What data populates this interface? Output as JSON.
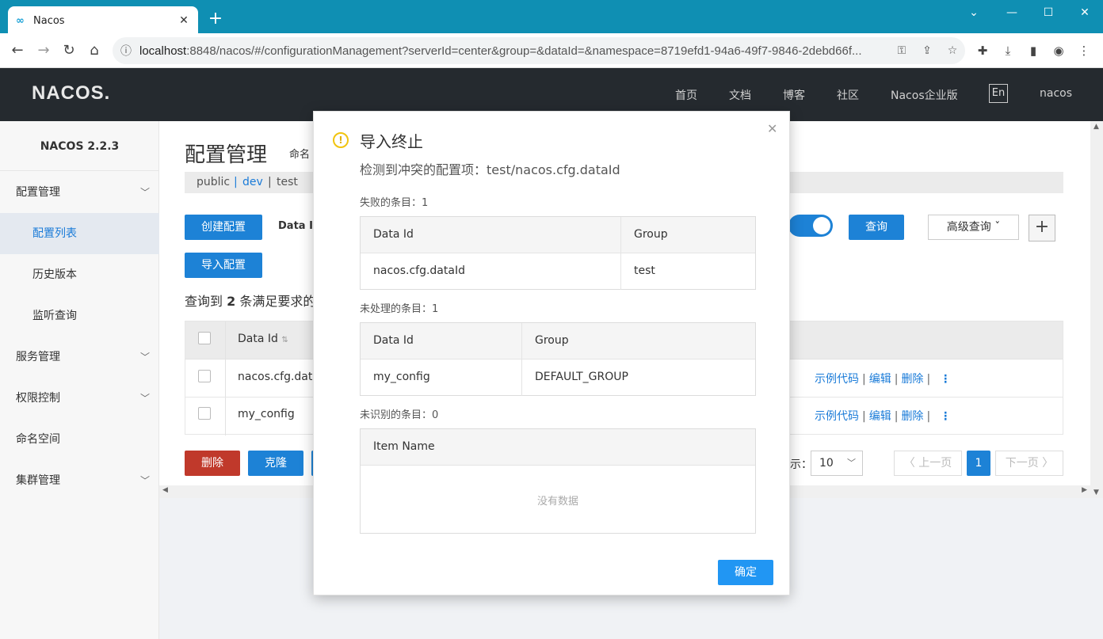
{
  "browser": {
    "tab_title": "Nacos",
    "tab_logo": "∞",
    "url_host": "localhost",
    "url_rest": ":8848/nacos/#/configurationManagement?serverId=center&group=&dataId=&namespace=8719efd1-94a6-49f7-9846-2debd66f..."
  },
  "header": {
    "logo": "NACOS.",
    "nav": [
      "首页",
      "文档",
      "博客",
      "社区",
      "Nacos企业版"
    ],
    "lang": "En",
    "user": "nacos"
  },
  "sidebar": {
    "version": "NACOS 2.2.3",
    "items": [
      {
        "label": "配置管理"
      },
      {
        "label": "配置列表"
      },
      {
        "label": "历史版本"
      },
      {
        "label": "监听查询"
      },
      {
        "label": "服务管理"
      },
      {
        "label": "权限控制"
      },
      {
        "label": "命名空间"
      },
      {
        "label": "集群管理"
      }
    ]
  },
  "main": {
    "title": "配置管理",
    "ns_label": "命名",
    "namespaces": [
      "public",
      "dev",
      "test"
    ],
    "create_btn": "创建配置",
    "import_btn": "导入配置",
    "dataid_label": "Data ID",
    "query_btn": "查询",
    "advanced_btn": "高级查询 ˇ",
    "result_prefix": "查询到",
    "result_count": "2",
    "result_suffix": "条满足要求的",
    "col_dataid": "Data Id",
    "rows": [
      {
        "dataid": "nacos.cfg.datal"
      },
      {
        "dataid": "my_config"
      }
    ],
    "ops": {
      "sample": "示例代码",
      "edit": "编辑",
      "delete": "删除"
    },
    "delete_btn": "删除",
    "clone_btn": "克隆",
    "page_show_label": "示：",
    "page_size": "10",
    "prev_page": "〈 上一页",
    "current_page": "1",
    "next_page": "下一页 〉"
  },
  "modal": {
    "title": "导入终止",
    "subtitle": "检测到冲突的配置项：test/nacos.cfg.dataId",
    "failed_label": "失败的条目：1",
    "failed_headers": [
      "Data Id",
      "Group"
    ],
    "failed_rows": [
      [
        "nacos.cfg.dataId",
        "test"
      ]
    ],
    "skipped_label": "未处理的条目：1",
    "skipped_headers": [
      "Data Id",
      "Group"
    ],
    "skipped_rows": [
      [
        "my_config",
        "DEFAULT_GROUP"
      ]
    ],
    "unknown_label": "未识别的条目：0",
    "unknown_header": "Item Name",
    "empty_text": "没有数据",
    "confirm": "确定"
  },
  "colors": {
    "chrome": "#0f8fb3",
    "header": "#252a2f",
    "primary": "#1d82d6",
    "danger": "#c0392b",
    "warn": "#f1c40f"
  }
}
